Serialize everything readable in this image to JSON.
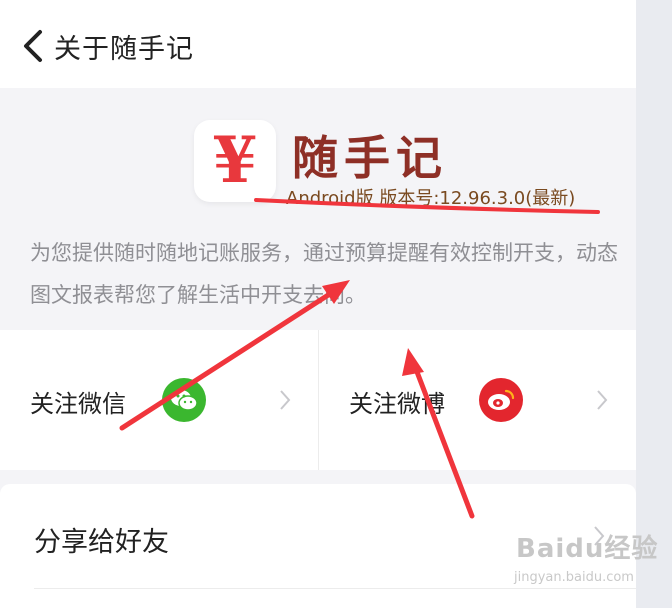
{
  "header": {
    "title": "关于随手记"
  },
  "app": {
    "logo_symbol": "¥",
    "name": "随手记",
    "version_text": "Android版 版本号:12.96.3.0(最新)",
    "description": "为您提供随时随地记账服务，通过预算提醒有效控制开支，动态图文报表帮您了解生活中开支去向。"
  },
  "follow": {
    "wechat_label": "关注微信",
    "weibo_label": "关注微博"
  },
  "share": {
    "label": "分享给好友"
  },
  "watermark": {
    "text": "Baidu经验",
    "sub": "jingyan.baidu.com"
  },
  "colors": {
    "accent_red": "#e8383d",
    "wechat_green": "#3bb72f",
    "weibo_red": "#e3262e",
    "annotation_red": "#f0353c"
  },
  "icons": {
    "back": "chevron-left-icon",
    "wechat": "wechat-icon",
    "weibo": "weibo-icon",
    "chevron": "chevron-right-icon"
  }
}
